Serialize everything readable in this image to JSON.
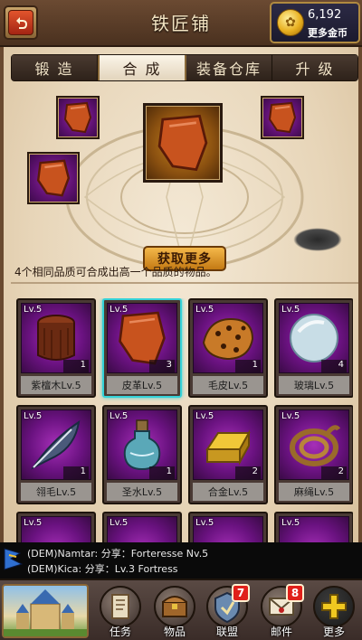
{
  "header": {
    "title": "铁匠铺",
    "gold_amount": "6,192",
    "more_gold_label": "更多金币"
  },
  "tabs": [
    {
      "label": "锻 造",
      "active": false
    },
    {
      "label": "合 成",
      "active": true
    },
    {
      "label": "装备仓库",
      "active": false
    },
    {
      "label": "升 级",
      "active": false
    }
  ],
  "forge": {
    "get_more_label": "获取更多",
    "info_text": "4个相同品质可合成出高一个品质的物品。"
  },
  "items": [
    {
      "level": "Lv.5",
      "qty": "1",
      "name": "紫檀木Lv.5",
      "icon": "wood-log-icon",
      "selected": false
    },
    {
      "level": "Lv.5",
      "qty": "3",
      "name": "皮革Lv.5",
      "icon": "leather-icon",
      "selected": true
    },
    {
      "level": "Lv.5",
      "qty": "1",
      "name": "毛皮Lv.5",
      "icon": "fur-icon",
      "selected": false
    },
    {
      "level": "Lv.5",
      "qty": "4",
      "name": "玻璃Lv.5",
      "icon": "glass-orb-icon",
      "selected": false
    },
    {
      "level": "Lv.5",
      "qty": "1",
      "name": "翎毛Lv.5",
      "icon": "feather-icon",
      "selected": false
    },
    {
      "level": "Lv.5",
      "qty": "1",
      "name": "圣水Lv.5",
      "icon": "holy-water-icon",
      "selected": false
    },
    {
      "level": "Lv.5",
      "qty": "2",
      "name": "合金Lv.5",
      "icon": "alloy-ingot-icon",
      "selected": false
    },
    {
      "level": "Lv.5",
      "qty": "2",
      "name": "麻绳Lv.5",
      "icon": "rope-icon",
      "selected": false
    },
    {
      "level": "Lv.5",
      "qty": "",
      "name": "",
      "icon": "item-icon",
      "selected": false
    },
    {
      "level": "Lv.5",
      "qty": "",
      "name": "",
      "icon": "item-icon",
      "selected": false
    },
    {
      "level": "Lv.5",
      "qty": "",
      "name": "",
      "icon": "item-icon",
      "selected": false
    },
    {
      "level": "Lv.5",
      "qty": "",
      "name": "",
      "icon": "item-icon",
      "selected": false
    }
  ],
  "chat": {
    "line1": "(DEM)Namtar: 分享：Forteresse Nv.5",
    "line2": "(DEM)Kica: 分享：Lv.3 Fortress"
  },
  "nav": [
    {
      "label": "任务",
      "icon": "quest-scroll-icon",
      "badge": ""
    },
    {
      "label": "物品",
      "icon": "treasure-chest-icon",
      "badge": ""
    },
    {
      "label": "联盟",
      "icon": "alliance-icon",
      "badge": "7"
    },
    {
      "label": "邮件",
      "icon": "mail-icon",
      "badge": "8"
    },
    {
      "label": "更多",
      "icon": "plus-icon",
      "badge": ""
    }
  ],
  "colors": {
    "selected_border": "#35d2d8",
    "tab_active_bg": "#fbf5e8",
    "badge_red": "#e0201a",
    "rare_purple": "#6a1280"
  }
}
